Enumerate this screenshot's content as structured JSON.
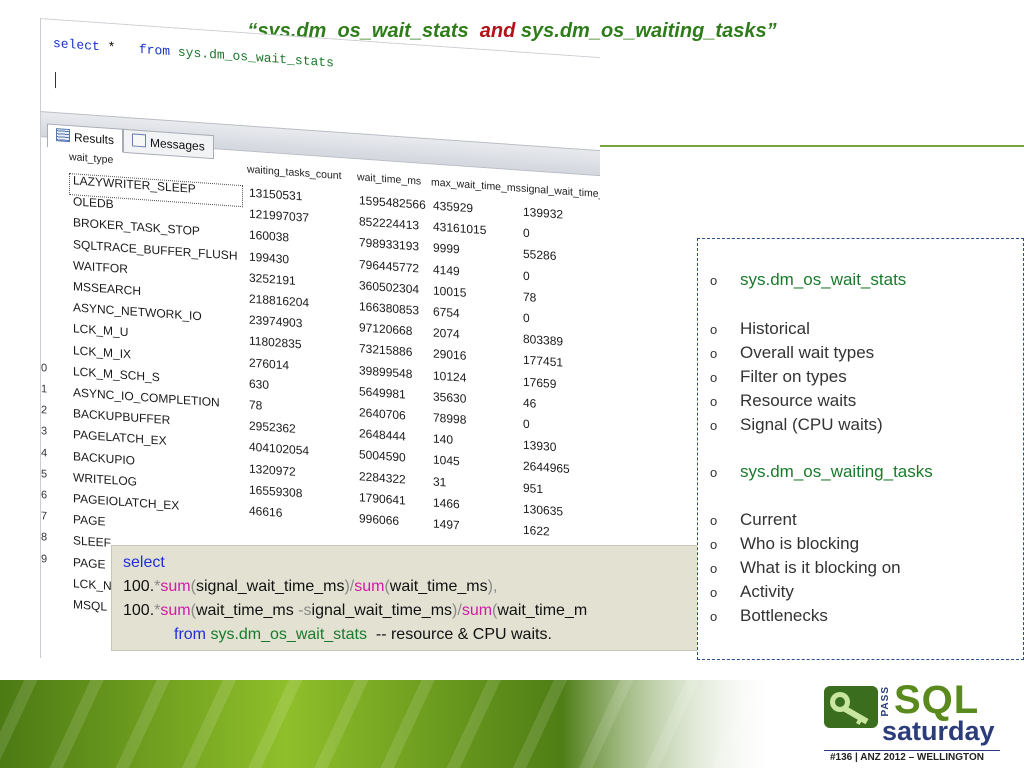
{
  "title": {
    "open_quote": "“",
    "part1": "sys.dm_os_wait_stats",
    "conj": "and",
    "part2": "sys.dm_os_waiting_tasks",
    "close_quote": "”"
  },
  "editor": {
    "kw_select": "select",
    "star": "*",
    "kw_from": "from",
    "object": "sys.dm_os_wait_stats"
  },
  "tabs": [
    {
      "label": "Results"
    },
    {
      "label": "Messages"
    }
  ],
  "grid": {
    "headers": [
      "wait_type",
      "waiting_tasks_count",
      "wait_time_ms",
      "max_wait_time_ms",
      "signal_wait_time_"
    ],
    "rows": [
      {
        "n": "",
        "type": "LAZYWRITER_SLEEP",
        "count": "13150531",
        "wait": "1595482566",
        "max": "435929",
        "signal": "139932"
      },
      {
        "n": "",
        "type": "OLEDB",
        "count": "121997037",
        "wait": "852224413",
        "max": "43161015",
        "signal": "0"
      },
      {
        "n": "",
        "type": "BROKER_TASK_STOP",
        "count": "160038",
        "wait": "798933193",
        "max": "9999",
        "signal": "55286"
      },
      {
        "n": "",
        "type": "SQLTRACE_BUFFER_FLUSH",
        "count": "199430",
        "wait": "796445772",
        "max": "4149",
        "signal": "0"
      },
      {
        "n": "",
        "type": "WAITFOR",
        "count": "3252191",
        "wait": "360502304",
        "max": "10015",
        "signal": "78"
      },
      {
        "n": "",
        "type": "MSSEARCH",
        "count": "218816204",
        "wait": "166380853",
        "max": "6754",
        "signal": "0"
      },
      {
        "n": "",
        "type": "ASYNC_NETWORK_IO",
        "count": "23974903",
        "wait": "97120668",
        "max": "2074",
        "signal": "803389"
      },
      {
        "n": "",
        "type": "LCK_M_U",
        "count": "11802835",
        "wait": "73215886",
        "max": "29016",
        "signal": "177451"
      },
      {
        "n": "",
        "type": "LCK_M_IX",
        "count": "276014",
        "wait": "39899548",
        "max": "10124",
        "signal": "17659"
      },
      {
        "n": "0",
        "type": "LCK_M_SCH_S",
        "count": "630",
        "wait": "5649981",
        "max": "35630",
        "signal": "46"
      },
      {
        "n": "1",
        "type": "ASYNC_IO_COMPLETION",
        "count": "78",
        "wait": "2640706",
        "max": "78998",
        "signal": "0"
      },
      {
        "n": "2",
        "type": "BACKUPBUFFER",
        "count": "2952362",
        "wait": "2648444",
        "max": "140",
        "signal": "13930"
      },
      {
        "n": "3",
        "type": "PAGELATCH_EX",
        "count": "404102054",
        "wait": "5004590",
        "max": "1045",
        "signal": "2644965"
      },
      {
        "n": "4",
        "type": "BACKUPIO",
        "count": "1320972",
        "wait": "2284322",
        "max": "31",
        "signal": "951"
      },
      {
        "n": "5",
        "type": "WRITELOG",
        "count": "16559308",
        "wait": "1790641",
        "max": "1466",
        "signal": "130635"
      },
      {
        "n": "6",
        "type": "PAGEIOLATCH_EX",
        "count": "46616",
        "wait": "996066",
        "max": "1497",
        "signal": "1622"
      },
      {
        "n": "7",
        "type": "PAGE",
        "count": "",
        "wait": "",
        "max": "",
        "signal": ""
      },
      {
        "n": "8",
        "type": "SLEEF",
        "count": "",
        "wait": "",
        "max": "",
        "signal": ""
      },
      {
        "n": "9",
        "type": "PAGE",
        "count": "",
        "wait": "",
        "max": "",
        "signal": ""
      },
      {
        "n": "",
        "type": "LCK_N",
        "count": "",
        "wait": "",
        "max": "",
        "signal": ""
      },
      {
        "n": "",
        "type": "MSQL",
        "count": "",
        "wait": "",
        "max": "",
        "signal": ""
      }
    ]
  },
  "sql": {
    "line1_select": "select",
    "line2_num": "100.",
    "line2_star": "*",
    "line2_fn": "sum",
    "line2_open": "(",
    "line2_col": "signal_wait_time_ms",
    "line2_close_div": ")/",
    "line2_fn2": "sum",
    "line2_open2": "(",
    "line2_col2": "wait_time_ms",
    "line2_close2": "),",
    "line3_num": "100.",
    "line3_star": "*",
    "line3_fn": "sum",
    "line3_open": "(",
    "line3_col": "wait_time_ms ",
    "line3_minus": "-s",
    "line3_col_b": "ignal_wait_time_ms",
    "line3_close_div": ")/",
    "line3_fn2": "sum",
    "line3_open2": "(",
    "line3_col2": "wait_time_m",
    "line4_from": "from",
    "line4_obj": "sys.dm_os_wait_stats",
    "line4_comment": "-- resource & CPU waits."
  },
  "bullets": [
    {
      "marker": "o",
      "text": "sys.dm_os_wait_stats",
      "highlight": true
    },
    {
      "marker": "o",
      "text": "Historical",
      "highlight": false
    },
    {
      "marker": "o",
      "text": "Overall wait types",
      "highlight": false
    },
    {
      "marker": "o",
      "text": "Filter on types",
      "highlight": false
    },
    {
      "marker": "o",
      "text": "Resource waits",
      "highlight": false
    },
    {
      "marker": "o",
      "text": "Signal (CPU waits)",
      "highlight": false
    },
    {
      "marker": "o",
      "text": "sys.dm_os_waiting_tasks",
      "highlight": true
    },
    {
      "marker": "o",
      "text": "Current",
      "highlight": false
    },
    {
      "marker": "o",
      "text": "Who is blocking",
      "highlight": false
    },
    {
      "marker": "o",
      "text": "What is it blocking on",
      "highlight": false
    },
    {
      "marker": "o",
      "text": "Activity",
      "highlight": false
    },
    {
      "marker": "o",
      "text": "Bottlenecks",
      "highlight": false
    }
  ],
  "logo": {
    "pass": "PASS",
    "sql": "SQL",
    "saturday": "saturday",
    "event": "#136 | ANZ 2012 – WELLINGTON"
  },
  "colors": {
    "green_text": "#2e7d1a",
    "red_text": "#b3121a",
    "keyword_blue": "#1f2fd6",
    "function_magenta": "#d21aa6",
    "panel_border": "#2a4d8f"
  }
}
